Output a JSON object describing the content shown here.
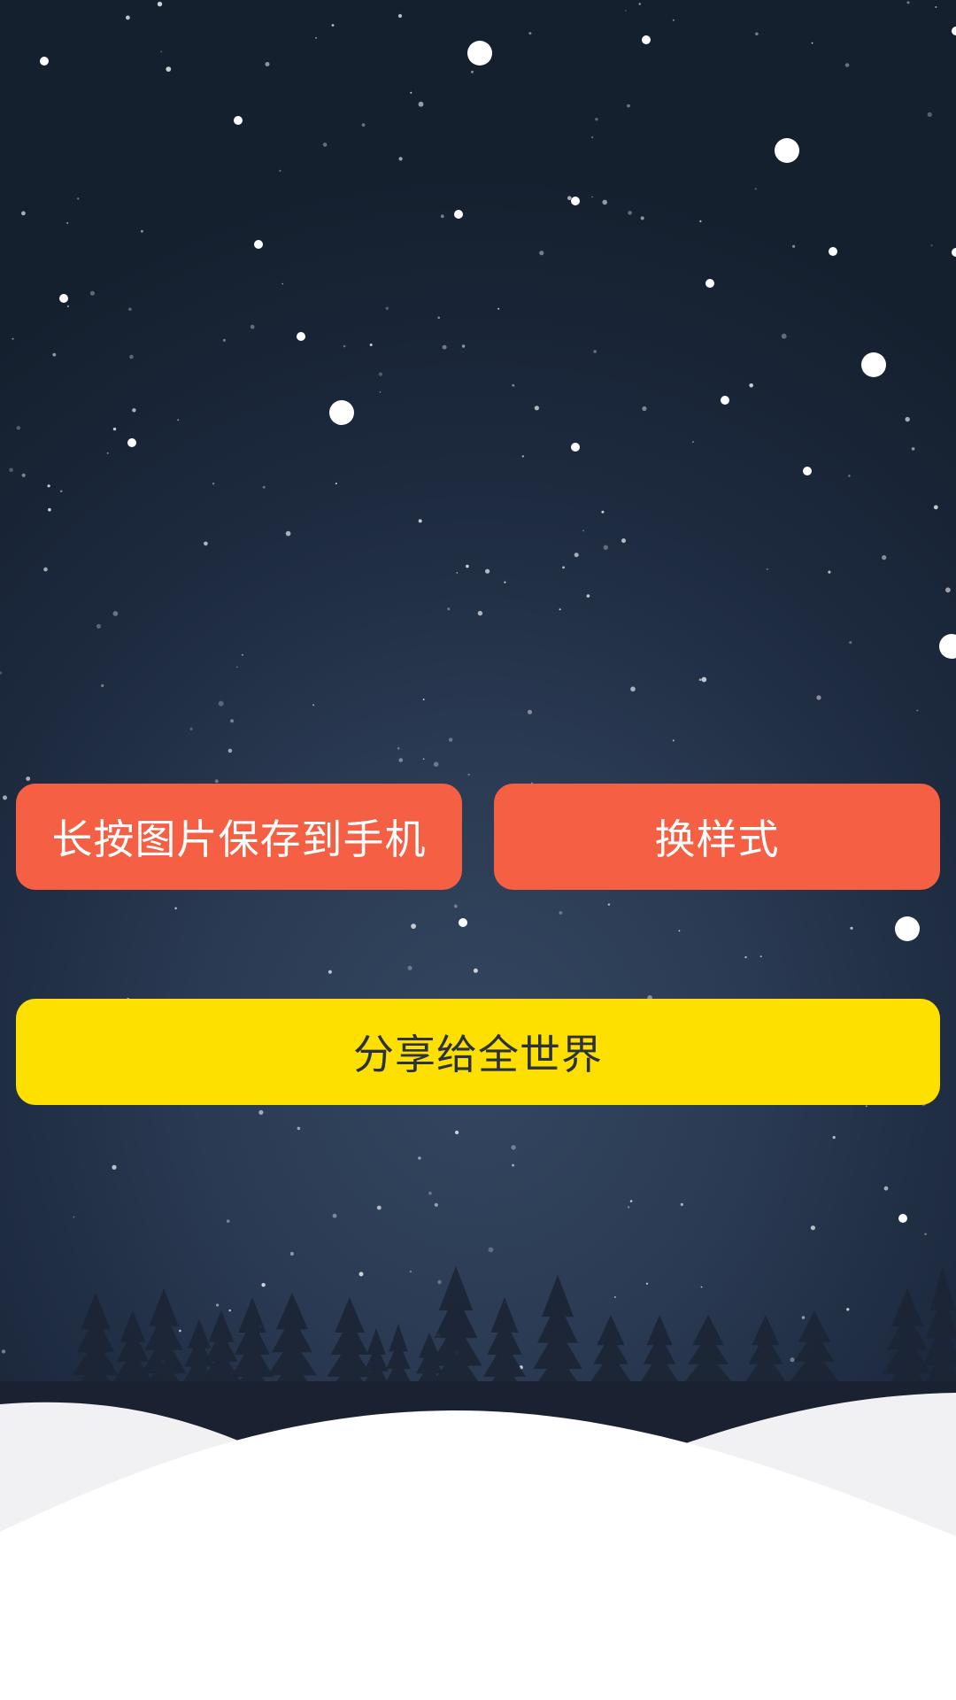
{
  "buttons": {
    "save_label": "长按图片保存到手机",
    "change_style_label": "换样式",
    "share_label": "分享给全世界"
  },
  "colors": {
    "sky_top": "#15202f",
    "sky_center": "#344660",
    "primary_button": "#f55f44",
    "share_button": "#fde000",
    "share_text": "#2b3140",
    "snow": "#ffffff",
    "snow_shadow": "#f1f1f3",
    "trees": "#1c2535"
  },
  "icons": [
    "snowflake-icon",
    "pine-tree-icon",
    "snow-hill-icon"
  ]
}
